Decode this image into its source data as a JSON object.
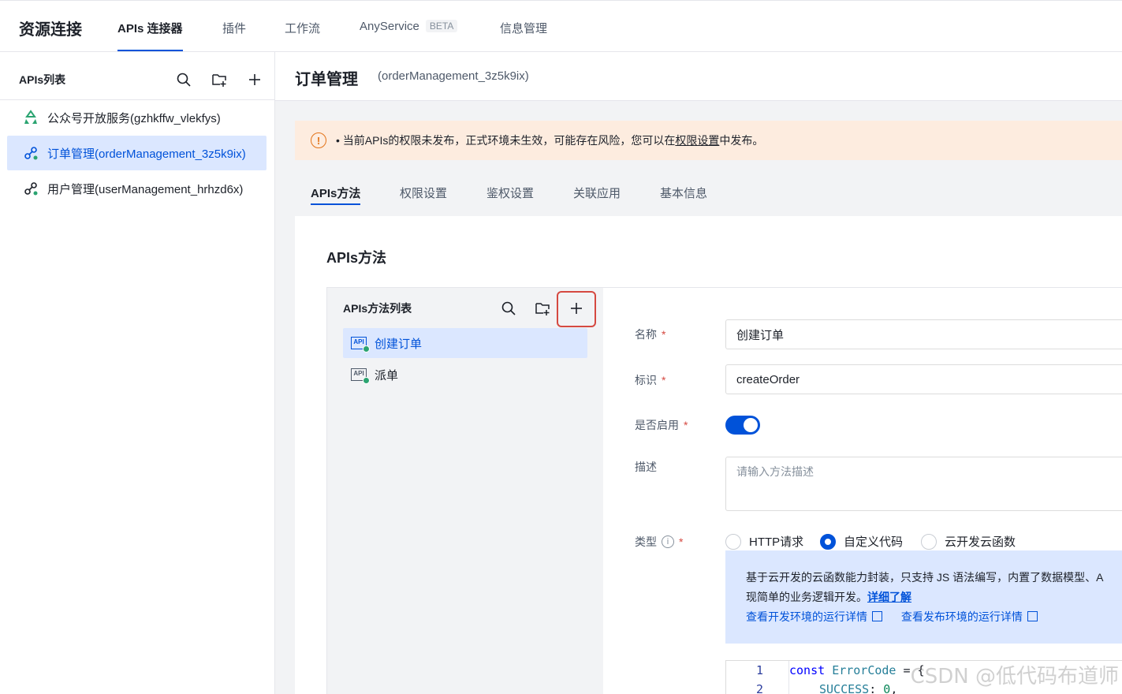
{
  "topbar": {
    "brand": "资源连接",
    "tabs": [
      {
        "label": "APIs 连接器"
      },
      {
        "label": "插件"
      },
      {
        "label": "工作流"
      },
      {
        "label": "AnyService",
        "badge": "BETA"
      },
      {
        "label": "信息管理"
      }
    ]
  },
  "sidebar": {
    "title": "APIs列表",
    "items": [
      {
        "label": "公众号开放服务(gzhkffw_vlekfys)"
      },
      {
        "label": "订单管理(orderManagement_3z5k9ix)"
      },
      {
        "label": "用户管理(userManagement_hrhzd6x)"
      }
    ]
  },
  "main": {
    "title": "订单管理",
    "subtitle": "(orderManagement_3z5k9ix)",
    "alert": {
      "text_before": "• 当前APIs的权限未发布，正式环境未生效，可能存在风险，您可以在",
      "link": "权限设置",
      "text_after": "中发布。"
    },
    "tabs": [
      {
        "label": "APIs方法"
      },
      {
        "label": "权限设置"
      },
      {
        "label": "鉴权设置"
      },
      {
        "label": "关联应用"
      },
      {
        "label": "基本信息"
      }
    ],
    "panel_title": "APIs方法"
  },
  "method_list": {
    "title": "APIs方法列表",
    "icon_text": "API",
    "items": [
      {
        "label": "创建订单"
      },
      {
        "label": "派单"
      }
    ]
  },
  "form": {
    "name_label": "名称",
    "name_value": "创建订单",
    "id_label": "标识",
    "id_value": "createOrder",
    "enabled_label": "是否启用",
    "desc_label": "描述",
    "desc_placeholder": "请输入方法描述",
    "type_label": "类型",
    "required_mark": "*",
    "type_options": [
      {
        "label": "HTTP请求",
        "checked": false
      },
      {
        "label": "自定义代码",
        "checked": true
      },
      {
        "label": "云开发云函数",
        "checked": false
      }
    ],
    "info": {
      "line1": "基于云开发的云函数能力封装，只支持 JS 语法编写，内置了数据模型、A",
      "line2": "现简单的业务逻辑开发。",
      "more": "详细了解",
      "link_dev": "查看开发环境的运行详情",
      "link_prod": "查看发布环境的运行详情"
    },
    "code": {
      "line_numbers": [
        "1",
        "2"
      ],
      "line1": {
        "kw": "const",
        "id": "ErrorCode",
        "rest": " = {"
      },
      "line2": {
        "key": "SUCCESS",
        "num": "0",
        "rest": ","
      }
    }
  },
  "watermark": "CSDN @低代码布道师",
  "colors": {
    "primary": "#0052d9",
    "warning": "#e37318",
    "danger": "#d54941",
    "success": "#2ba471"
  }
}
